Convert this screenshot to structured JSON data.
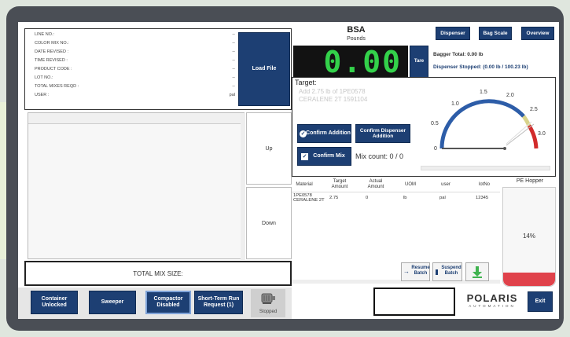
{
  "colors": {
    "navy": "#1d3f73",
    "scale_green": "#33d14a",
    "gauge_blue": "#2d5da8",
    "gauge_red": "#d22b2b",
    "hopper_red": "#e0424b"
  },
  "info": {
    "labels": [
      "LINE NO.:",
      "COLOR MIX NO.:",
      "DATE REVISED :",
      "TIME REVISED :",
      "PRODUCT CODE :",
      "LOT NO.:",
      "TOTAL MIXES REQD :",
      "USER :"
    ],
    "values": [
      "--",
      "--",
      "--",
      "--",
      "--",
      "--",
      "--",
      "pal"
    ],
    "load_file": "Load File"
  },
  "list_nav": {
    "up": "Up",
    "down": "Down"
  },
  "total_mix_size": "TOTAL MIX SIZE:",
  "scale": {
    "title": "BSA",
    "unit": "Pounds",
    "reading": "0.00",
    "tare": "Tare",
    "bagger_total": "Bagger Total: 0.00 lb",
    "dispenser_stopped": "Dispenser Stopped: (0.00 lb / 100.23 lb)"
  },
  "top_nav": {
    "dispenser": "Dispenser",
    "bag_scale": "Bag Scale",
    "overview": "Overview"
  },
  "target": {
    "label": "Target:",
    "instruction": "Add 2.75 lb of 1PE0578 CERALENE 2T 1591104",
    "confirm_addition": "Confirm Addition",
    "confirm_dispenser_addition": "Confirm Dispenser Addition",
    "confirm_mix": "Confirm Mix",
    "mix_count": "Mix count: 0 / 0"
  },
  "gauge": {
    "ticks": [
      "0",
      "0.5",
      "1.0",
      "1.5",
      "2.0",
      "2.5",
      "3.0"
    ],
    "min": 0,
    "max": 3.0,
    "value": 0.0,
    "target": 2.75
  },
  "table": {
    "headers": [
      "Material",
      "Target Amount",
      "Actual Amount",
      "UOM",
      "user",
      "lotNo"
    ],
    "rows": [
      [
        "1PE0578 CERALENE 2T",
        "2.75",
        "0",
        "lb",
        "pal",
        "12345"
      ]
    ]
  },
  "batch": {
    "resume": "Resume Batch",
    "suspend": "Suspend Batch"
  },
  "hopper": {
    "title": "PE Hopper",
    "percent": "14%",
    "level": 0.14
  },
  "bottom": {
    "container_unlocked": "Container Unlocked",
    "sweeper": "Sweeper",
    "compactor_disabled": "Compactor Disabled",
    "short_term_run": "Short-Term Run Request (1)",
    "stopped": "Stopped",
    "exit": "Exit"
  },
  "logo": {
    "name": "POLARIS",
    "sub": "AUTOMATION"
  }
}
